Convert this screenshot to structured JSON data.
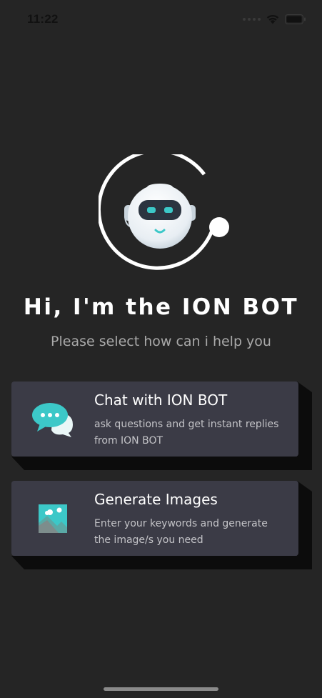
{
  "status_bar": {
    "time": "11:22"
  },
  "header": {
    "title": "Hi, I'm the ION BOT",
    "subtitle": "Please select how can i help you"
  },
  "options": [
    {
      "title": "Chat with ION BOT",
      "description": "ask questions and get instant replies from ION BOT",
      "icon": "chat-bubbles-icon"
    },
    {
      "title": "Generate Images",
      "description": "Enter your keywords and generate the image/s you need",
      "icon": "image-icon"
    }
  ],
  "colors": {
    "background": "#252525",
    "card": "#3b3b46",
    "accent": "#3cc8c8"
  }
}
